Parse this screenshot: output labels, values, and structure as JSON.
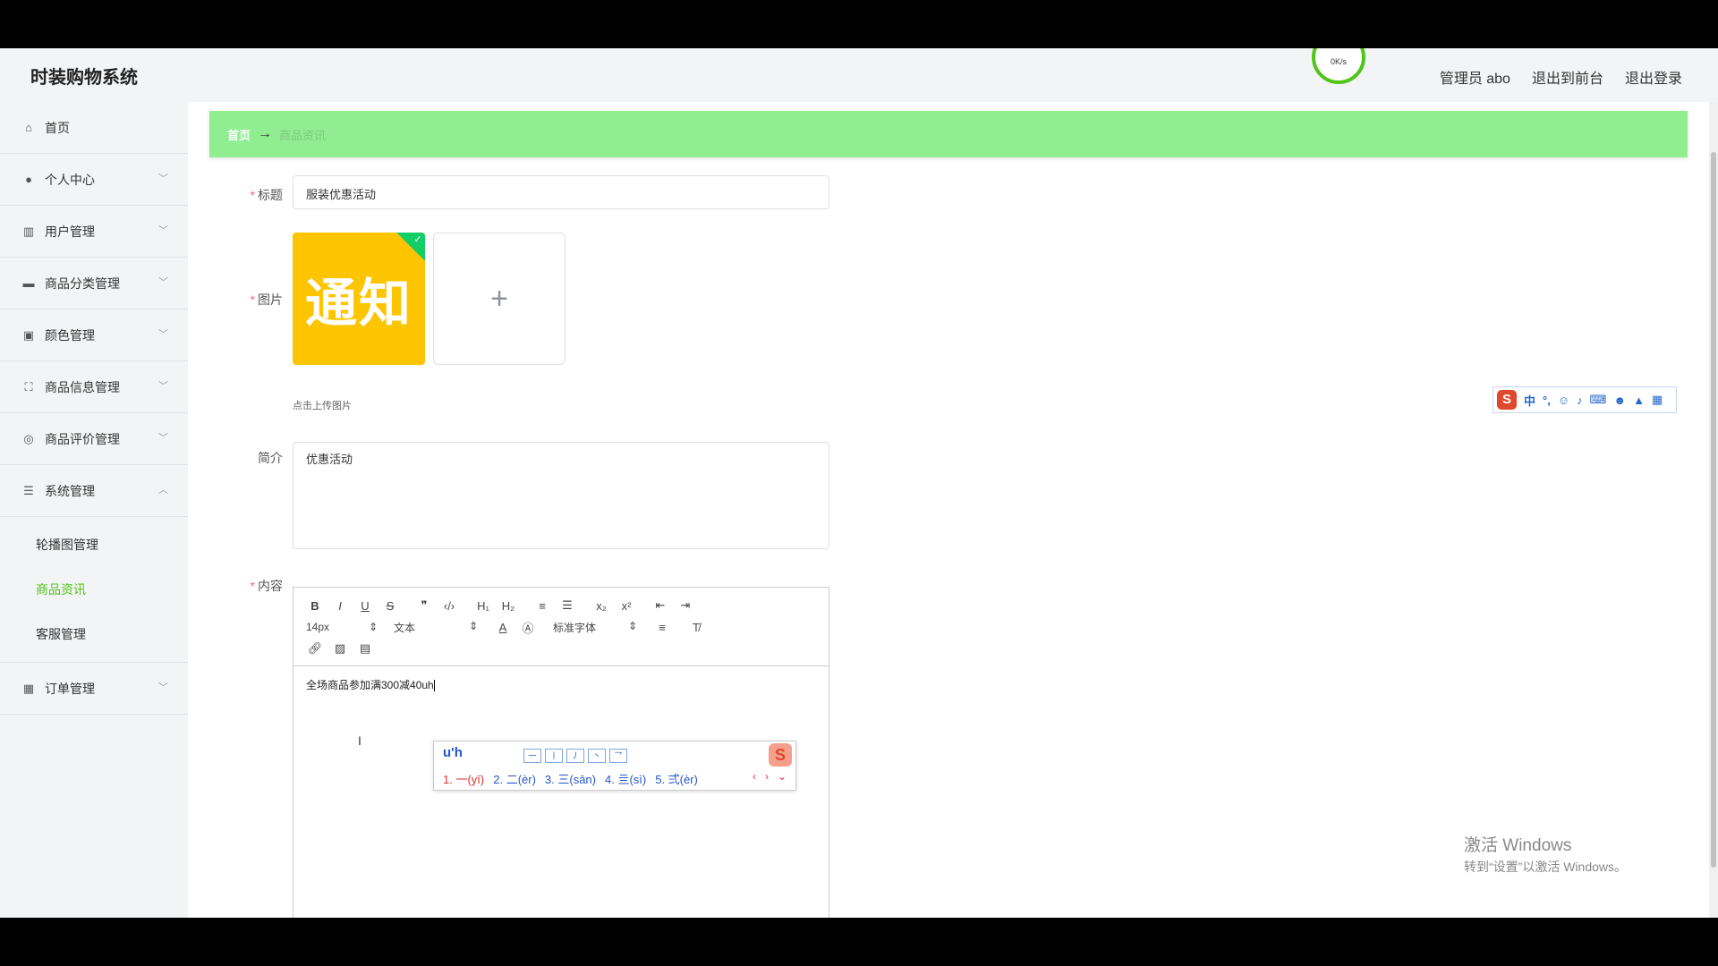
{
  "app": {
    "title": "时装购物系统"
  },
  "speed_widget": {
    "text": "0K/s"
  },
  "top_links": {
    "admin": "管理员 abo",
    "to_front": "退出到前台",
    "logout": "退出登录"
  },
  "sidebar": {
    "items": [
      {
        "label": "首页",
        "icon": "home-icon"
      },
      {
        "label": "个人中心",
        "icon": "user-icon"
      },
      {
        "label": "用户管理",
        "icon": "bar-chart-icon"
      },
      {
        "label": "商品分类管理",
        "icon": "briefcase-icon"
      },
      {
        "label": "颜色管理",
        "icon": "clipboard-icon"
      },
      {
        "label": "商品信息管理",
        "icon": "frame-icon"
      },
      {
        "label": "商品评价管理",
        "icon": "compass-icon"
      },
      {
        "label": "系统管理",
        "icon": "menu-icon"
      },
      {
        "label": "订单管理",
        "icon": "ticket-icon"
      }
    ],
    "system_sub": [
      {
        "label": "轮播图管理"
      },
      {
        "label": "商品资讯"
      },
      {
        "label": "客服管理"
      }
    ]
  },
  "breadcrumb": {
    "home": "首页",
    "arrow": "→",
    "current": "商品资讯"
  },
  "form": {
    "title_label": "标题",
    "title_value": "服装优惠活动",
    "image_label": "图片",
    "image_text": "通知",
    "upload_plus": "+",
    "upload_hint": "点击上传图片",
    "summary_label": "简介",
    "summary_value": "优惠活动",
    "content_label": "内容",
    "content_text": "全场商品参加满300减40uh"
  },
  "editor": {
    "toolbar_row1": [
      "B",
      "I",
      "U",
      "S",
      "❞",
      "‹/›",
      "H₁",
      "H₂",
      "≡",
      "☰",
      "x₂",
      "x²",
      "⇤",
      "⇥"
    ],
    "size_value": "14px",
    "format_value": "文本",
    "font_value": "标准字体",
    "size_select_arrow": "⇕",
    "format_select_arrow": "⇕",
    "font_select_arrow": "⇕"
  },
  "ime": {
    "input": "u'h",
    "tones": [
      "一",
      "丨",
      "丿",
      "丶",
      "乛"
    ],
    "candidates": [
      "1. 一(yī)",
      "2. 二(èr)",
      "3. 三(sān)",
      "4. 亖(sì)",
      "5. 弍(èr)"
    ],
    "logo": "S",
    "bar_label": "中"
  },
  "watermark": {
    "line1": "激活 Windows",
    "line2": "转到“设置”以激活 Windows。"
  },
  "colors": {
    "accent": "#52c41a",
    "breadcrumb_bg": "#90ee90",
    "required": "#f56c6c"
  }
}
